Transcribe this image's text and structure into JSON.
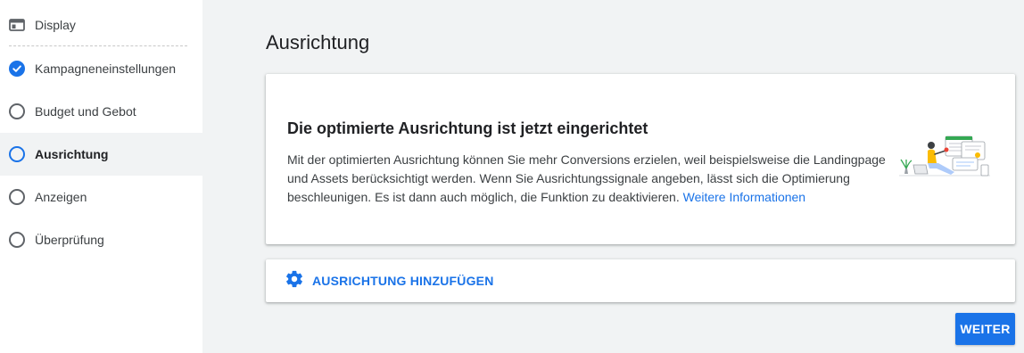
{
  "sidebar": {
    "items": [
      {
        "label": "Display",
        "icon": "display-icon",
        "state": "header"
      },
      {
        "label": "Kampagneneinstellungen",
        "icon": "check-circle-icon",
        "state": "completed"
      },
      {
        "label": "Budget und Gebot",
        "icon": "empty-circle-icon",
        "state": "pending"
      },
      {
        "label": "Ausrichtung",
        "icon": "empty-circle-icon",
        "state": "current"
      },
      {
        "label": "Anzeigen",
        "icon": "empty-circle-icon",
        "state": "pending"
      },
      {
        "label": "Überprüfung",
        "icon": "empty-circle-icon",
        "state": "pending"
      }
    ]
  },
  "main": {
    "title": "Ausrichtung",
    "info_card": {
      "title": "Die optimierte Ausrichtung ist jetzt eingerichtet",
      "text": "Mit der optimierten Ausrichtung können Sie mehr Conversions erzielen, weil beispielsweise die Landingpage und Assets berücksichtigt werden. Wenn Sie Ausrichtungssignale angeben, lässt sich die Optimierung beschleunigen. Es ist dann auch möglich, die Funktion zu deaktivieren.",
      "link": "Weitere Informationen"
    },
    "add_targeting_label": "AUSRICHTUNG HINZUFÜGEN",
    "next_button": "WEITER"
  },
  "colors": {
    "accent": "#1a73e8",
    "background": "#f1f3f4",
    "text": "#202124"
  }
}
